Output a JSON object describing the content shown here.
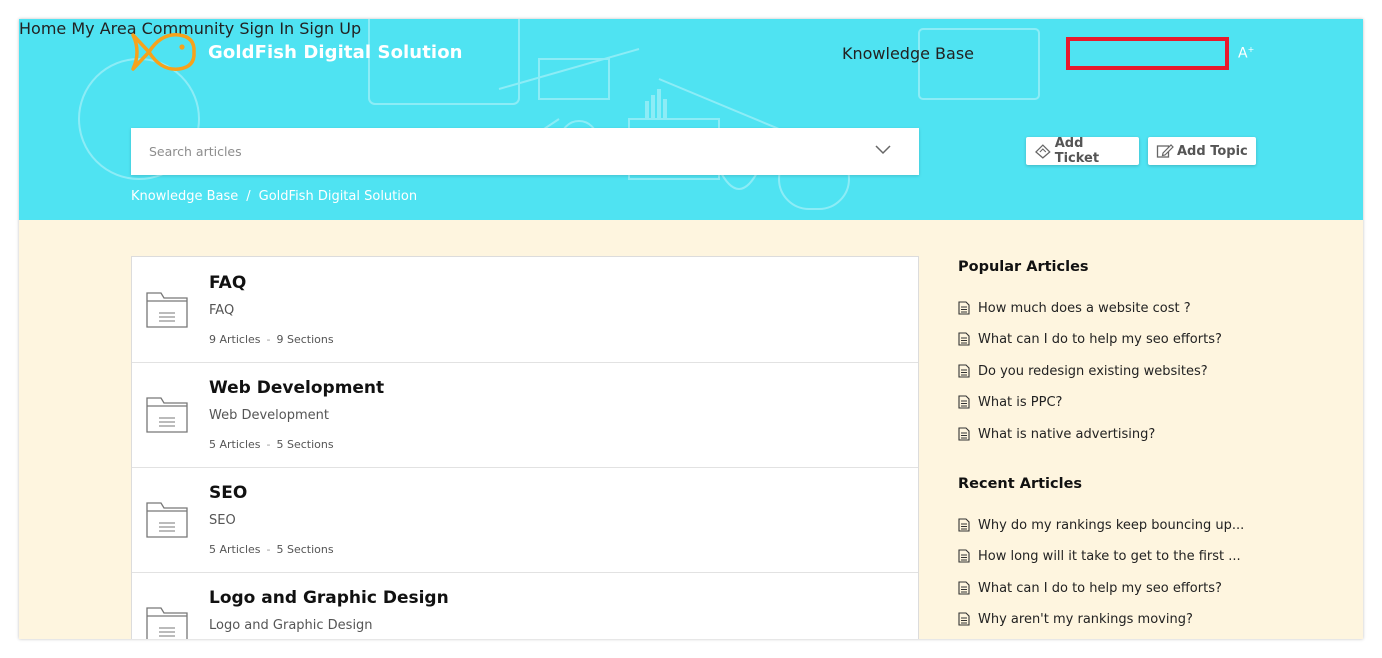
{
  "brand": {
    "name": "GoldFish Digital Solution",
    "logo_color": "#f7a21b"
  },
  "nav": {
    "items": [
      {
        "label": "Home"
      },
      {
        "label": "My Area"
      },
      {
        "label": "Knowledge Base"
      },
      {
        "label": "Community"
      },
      {
        "label": "Sign In"
      },
      {
        "label": "Sign Up"
      }
    ],
    "active": "Knowledge Base",
    "font_size_icon": "A"
  },
  "search": {
    "placeholder": "Search articles",
    "value": ""
  },
  "actions": {
    "add_ticket": "Add Ticket",
    "add_topic": "Add Topic"
  },
  "breadcrumb": {
    "root": "Knowledge Base",
    "separator": "/",
    "current": "GoldFish Digital Solution"
  },
  "categories": [
    {
      "title": "FAQ",
      "description": "FAQ",
      "articles": "9 Articles",
      "sections": "9 Sections"
    },
    {
      "title": "Web Development",
      "description": "Web Development",
      "articles": "5 Articles",
      "sections": "5 Sections"
    },
    {
      "title": "SEO",
      "description": "SEO",
      "articles": "5 Articles",
      "sections": "5 Sections"
    },
    {
      "title": "Logo and Graphic Design",
      "description": "Logo and Graphic Design",
      "articles": "",
      "sections": ""
    }
  ],
  "popular": {
    "heading": "Popular Articles",
    "items": [
      "How much does a website cost ?",
      "What can I do to help my seo efforts?",
      "Do you redesign existing websites?",
      "What is PPC?",
      "What is native advertising?"
    ]
  },
  "recent": {
    "heading": "Recent Articles",
    "items": [
      "Why do my rankings keep bouncing up...",
      "How long will it take to get to the first ...",
      "What can I do to help my seo efforts?",
      "Why aren't my rankings moving?"
    ]
  },
  "colors": {
    "header": "#4fe3f2",
    "body": "#fef5df",
    "highlight": "#e8192c"
  }
}
